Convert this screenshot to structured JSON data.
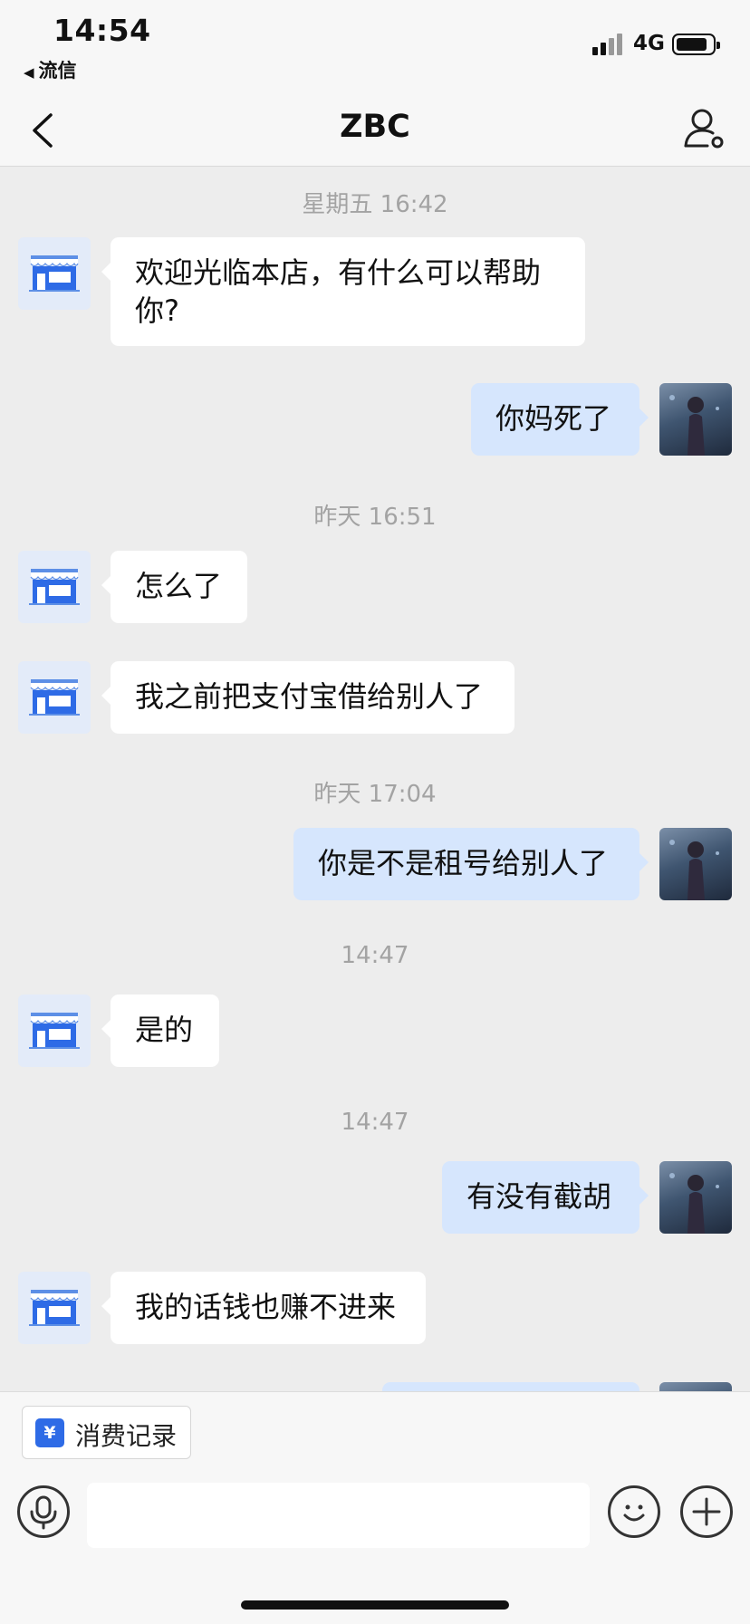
{
  "status_bar": {
    "time": "14:54",
    "back_app": "流信",
    "network": "4G"
  },
  "nav": {
    "title": "ZBC"
  },
  "messages": [
    {
      "type": "time",
      "text": "星期五 16:42"
    },
    {
      "type": "in",
      "text": "欢迎光临本店，有什么可以帮助你?"
    },
    {
      "type": "out",
      "text": "你妈死了"
    },
    {
      "type": "time",
      "text": "昨天 16:51"
    },
    {
      "type": "in",
      "text": "怎么了"
    },
    {
      "type": "in",
      "text": "我之前把支付宝借给别人了"
    },
    {
      "type": "time",
      "text": "昨天 17:04"
    },
    {
      "type": "out",
      "text": "你是不是租号给别人了"
    },
    {
      "type": "time",
      "text": "14:47"
    },
    {
      "type": "in",
      "text": "是的"
    },
    {
      "type": "time",
      "text": "14:47"
    },
    {
      "type": "out",
      "text": "有没有截胡"
    },
    {
      "type": "in",
      "text": "我的话钱也赚不进来"
    },
    {
      "type": "out",
      "text": ""
    }
  ],
  "bottom": {
    "consume_label": "消费记录",
    "consume_icon": "¥",
    "input_value": ""
  },
  "icons": {
    "back": "chevron-left-icon",
    "profile": "person-settings-icon",
    "microphone": "microphone-icon",
    "emoji": "smiley-icon",
    "plus": "plus-icon",
    "receipt": "receipt-yen-icon"
  },
  "colors": {
    "bubble_in": "#ffffff",
    "bubble_out": "#d6e6fd",
    "background": "#ededed",
    "accent": "#2e6be6"
  }
}
